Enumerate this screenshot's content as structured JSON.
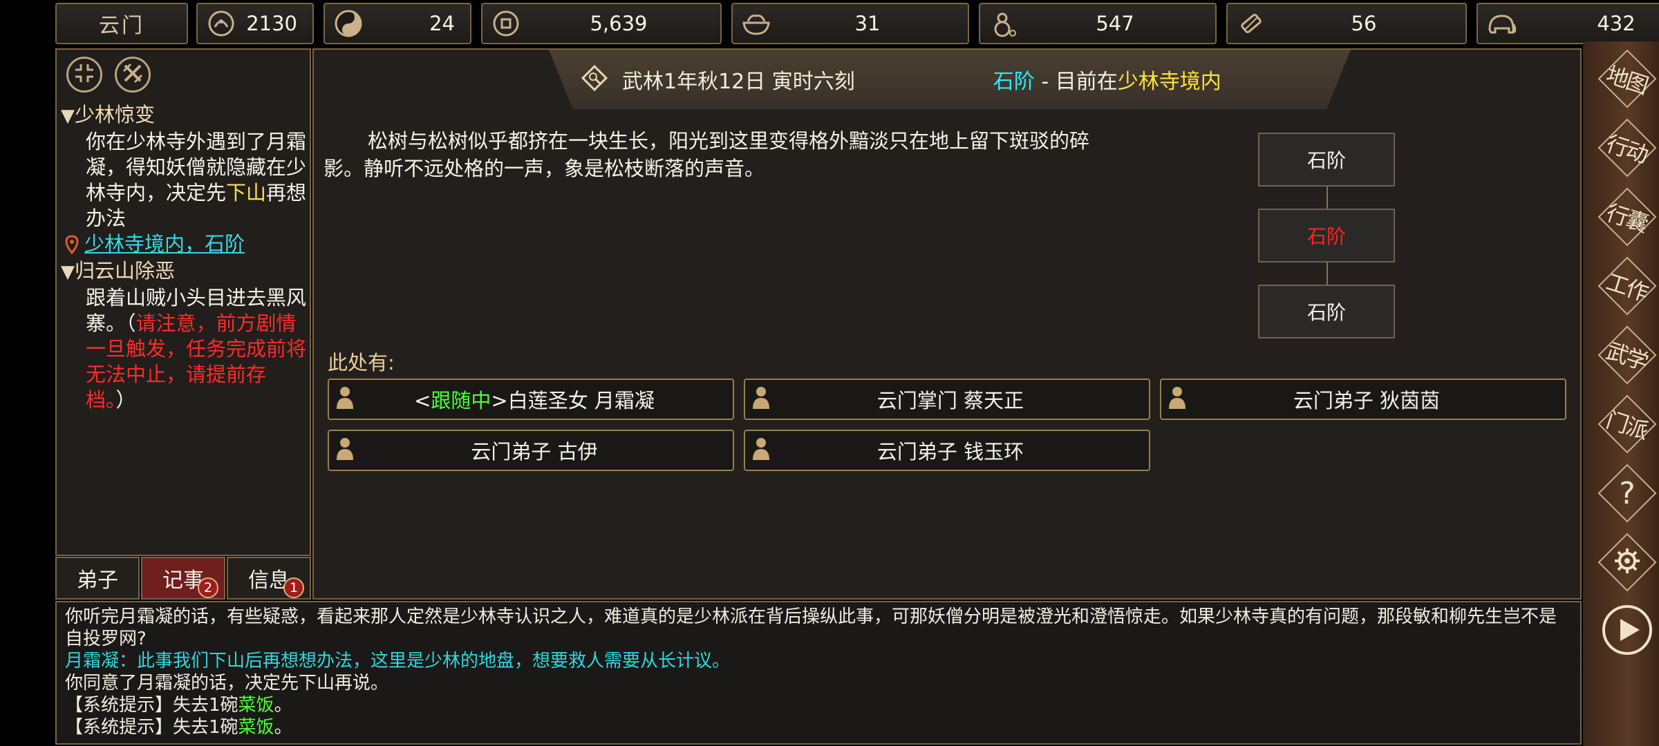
{
  "topbar": {
    "sect_name": "云门",
    "resources": [
      {
        "icon": "reputation-icon",
        "value": "2130"
      },
      {
        "icon": "yin-yang-icon",
        "value": "24"
      },
      {
        "icon": "coin-icon",
        "value": "5,639"
      },
      {
        "icon": "food-bowl-icon",
        "value": "31"
      },
      {
        "icon": "gourd-icon",
        "value": "547"
      },
      {
        "icon": "scroll-icon",
        "value": "56"
      },
      {
        "icon": "elephant-icon",
        "value": "432"
      }
    ]
  },
  "quests": [
    {
      "title": "少林惊变",
      "desc_parts": [
        "你在少林寺外遇到了月霜凝，得知妖僧就隐藏在少林寺内，决定先",
        "下山",
        "再想办法"
      ],
      "location": "少林寺境内，石阶"
    },
    {
      "title": "归云山除恶",
      "desc_parts": [
        "跟着山贼小头目进去黑风寨。（",
        "请注意，前方剧情一旦触发，任务完成前将无法中止，请提前存档。",
        "）"
      ]
    }
  ],
  "left_tabs": [
    {
      "label": "弟子",
      "badge": ""
    },
    {
      "label": "记事",
      "badge": "2"
    },
    {
      "label": "信息",
      "badge": "1"
    }
  ],
  "header": {
    "date": "武林1年秋12日 寅时六刻",
    "place": "石阶",
    "separator": " - 目前在",
    "region": "少林寺境内"
  },
  "scene": {
    "description": "松树与松树似乎都挤在一块生长，阳光到这里变得格外黯淡只在地上留下斑驳的碎影。静听不远处格的一声，象是松枝断落的声音。",
    "here_label": "此处有:"
  },
  "map_nodes": [
    "石阶",
    "石阶",
    "石阶"
  ],
  "npcs": [
    {
      "tag_open": "<",
      "tag": "跟随中",
      "tag_close": ">",
      "name": "白莲圣女 月霜凝"
    },
    {
      "name": "云门掌门 蔡天正"
    },
    {
      "name": "云门弟子 狄茵茵"
    },
    {
      "name": "云门弟子 古伊"
    },
    {
      "name": "云门弟子 钱玉环"
    }
  ],
  "log": {
    "line1": "你听完月霜凝的话，有些疑惑，看起来那人定然是少林寺认识之人，难道真的是少林派在背后操纵此事，可那妖僧分明是被澄光和澄悟惊走。如果少林寺真的有问题，那段敏和柳先生岂不是自投罗网?",
    "line2": "月霜凝：此事我们下山后再想想办法，这里是少林的地盘，想要救人需要从长计议。",
    "line3": "你同意了月霜凝的话，决定先下山再说。",
    "sys_prefix": "【系统提示】失去1碗",
    "sys_item": "菜饭",
    "sys_suffix": "。"
  },
  "right_menu": [
    "地图",
    "行动",
    "行囊",
    "工作",
    "武学",
    "门派"
  ],
  "colors": {
    "accent_gold": "#7a6440",
    "highlight_yellow": "#ffe14a",
    "warning_red": "#ff2a2a",
    "cyan": "#2fe7ff",
    "green": "#4bff38"
  }
}
